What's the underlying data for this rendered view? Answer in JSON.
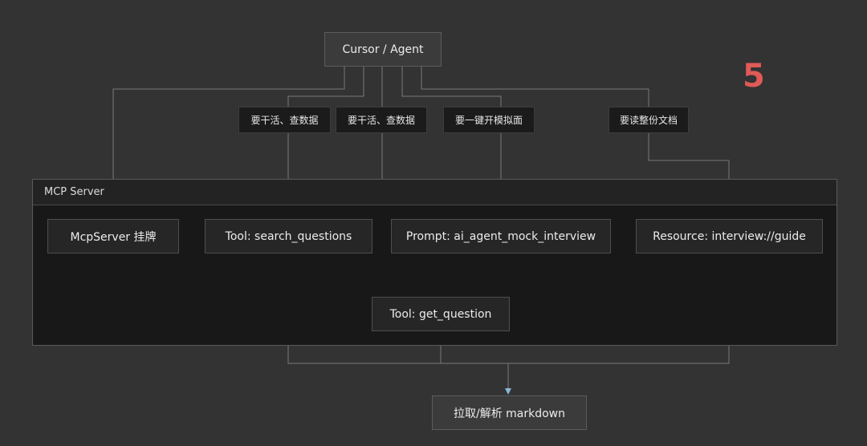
{
  "step_number": "5",
  "nodes": {
    "agent": "Cursor / Agent",
    "server_title": "MCP Server",
    "mcpserver": "McpServer 挂牌",
    "search_tool": "Tool: search_questions",
    "prompt": "Prompt: ai_agent_mock_interview",
    "resource": "Resource: interview://guide",
    "get_tool": "Tool: get_question",
    "output": "拉取/解析 markdown"
  },
  "edge_labels": {
    "work_query_1": "要干活、查数据",
    "work_query_2": "要干活、查数据",
    "mock_interview": "要一键开模拟面",
    "read_doc": "要读整份文档"
  },
  "colors": {
    "background": "#333333",
    "line": "#7a7a7a",
    "arrow": "#8ab8d8",
    "step": "#e05a57"
  }
}
